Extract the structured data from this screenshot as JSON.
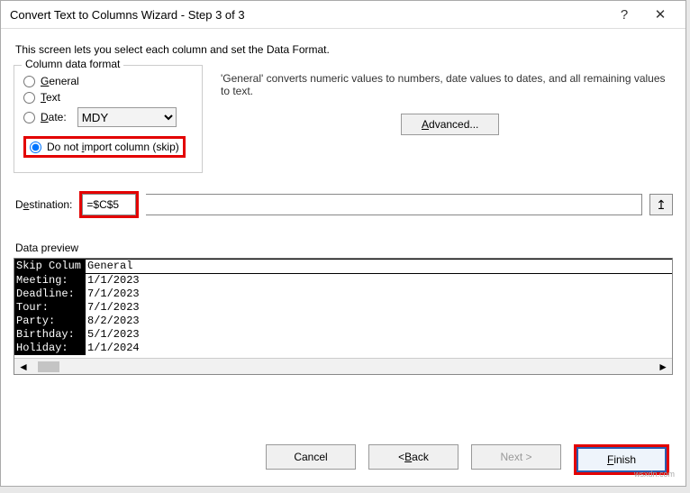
{
  "title": "Convert Text to Columns Wizard - Step 3 of 3",
  "instruction": "This screen lets you select each column and set the Data Format.",
  "format": {
    "legend": "Column data format",
    "general": "General",
    "text": "Text",
    "date": "Date:",
    "date_value": "MDY",
    "skip": "Do not import column (skip)"
  },
  "desc": "'General' converts numeric values to numbers, date values to dates, and all remaining values to text.",
  "advanced": "Advanced...",
  "destination_label": "Destination:",
  "destination_value": "=$C$5",
  "preview_label": "Data preview",
  "preview": {
    "headers": [
      "Skip Colum",
      "General"
    ],
    "rows": [
      [
        "Meeting:",
        "1/1/2023"
      ],
      [
        "Deadline:",
        "7/1/2023"
      ],
      [
        "Tour:",
        "7/1/2023"
      ],
      [
        "Party:",
        "8/2/2023"
      ],
      [
        "Birthday:",
        "5/1/2023"
      ],
      [
        "Holiday:",
        "1/1/2024"
      ]
    ]
  },
  "buttons": {
    "cancel": "Cancel",
    "back": "< Back",
    "next": "Next >",
    "finish": "Finish"
  },
  "watermark": "wsxdn.com"
}
